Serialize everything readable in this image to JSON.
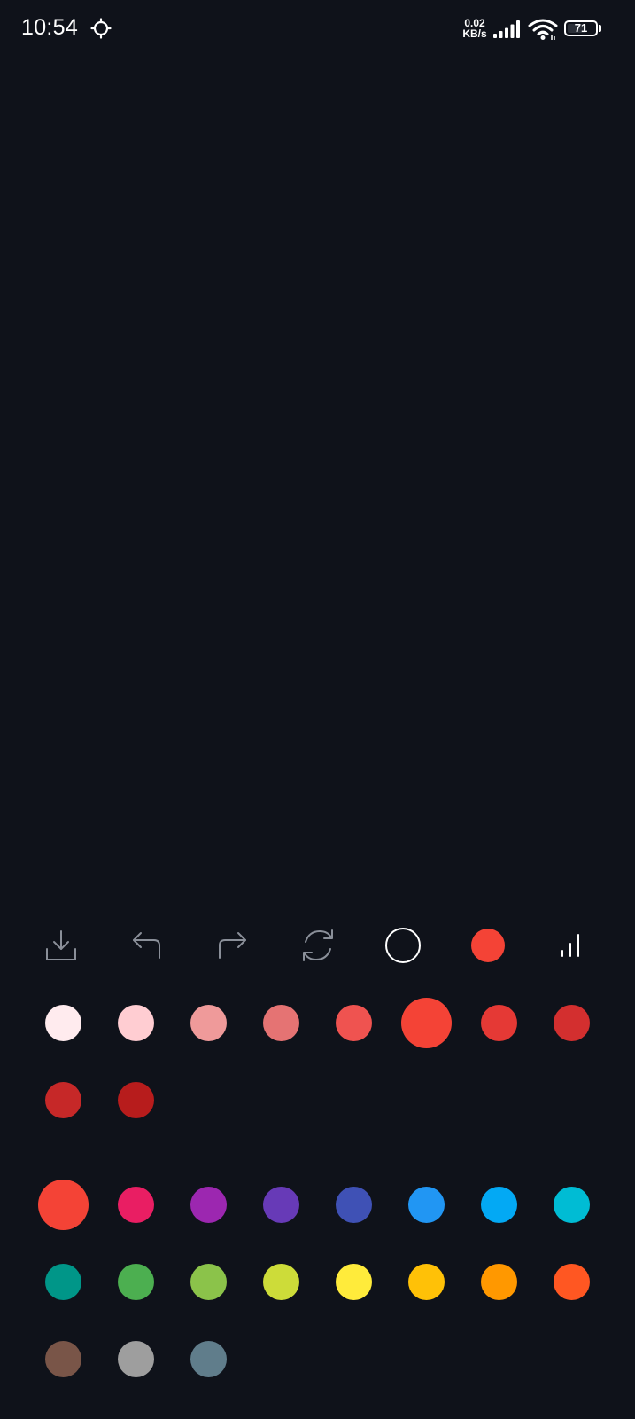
{
  "status_bar": {
    "time": "10:54",
    "net_speed_value": "0.02",
    "net_speed_unit": "KB/s",
    "battery": "71",
    "sync_icon": "sync-icon",
    "signal_icon": "cellular-signal-icon",
    "wifi_icon": "wifi-icon"
  },
  "toolbar": {
    "tools": [
      {
        "name": "download",
        "icon": "download-icon"
      },
      {
        "name": "undo",
        "icon": "undo-icon"
      },
      {
        "name": "redo",
        "icon": "redo-icon"
      },
      {
        "name": "clear",
        "icon": "refresh-icon"
      },
      {
        "name": "brush-size",
        "icon": "circle-outline-icon"
      },
      {
        "name": "current-color",
        "icon": "color-dot-icon",
        "color": "#f44336"
      },
      {
        "name": "stroke-width",
        "icon": "bar-chart-icon"
      }
    ],
    "icon_color": "#8a8f99"
  },
  "palette": {
    "selected_shade": "#f44336",
    "selected_hue": "#f44336",
    "shades": [
      "#ffebee",
      "#ffcdd2",
      "#ef9a9a",
      "#e57373",
      "#ef5350",
      "#f44336",
      "#e53935",
      "#d32f2f",
      "#c62828",
      "#b71c1c"
    ],
    "hues": [
      "#f44336",
      "#e91e63",
      "#9c27b0",
      "#673ab7",
      "#3f51b5",
      "#2196f3",
      "#03a9f4",
      "#00bcd4",
      "#009688",
      "#4caf50",
      "#8bc34a",
      "#cddc39",
      "#ffeb3b",
      "#ffc107",
      "#ff9800",
      "#ff5722",
      "#795548",
      "#9e9e9e",
      "#607d8b"
    ]
  },
  "colors": {
    "background": "#0f121a",
    "status_text": "#ffffff"
  }
}
